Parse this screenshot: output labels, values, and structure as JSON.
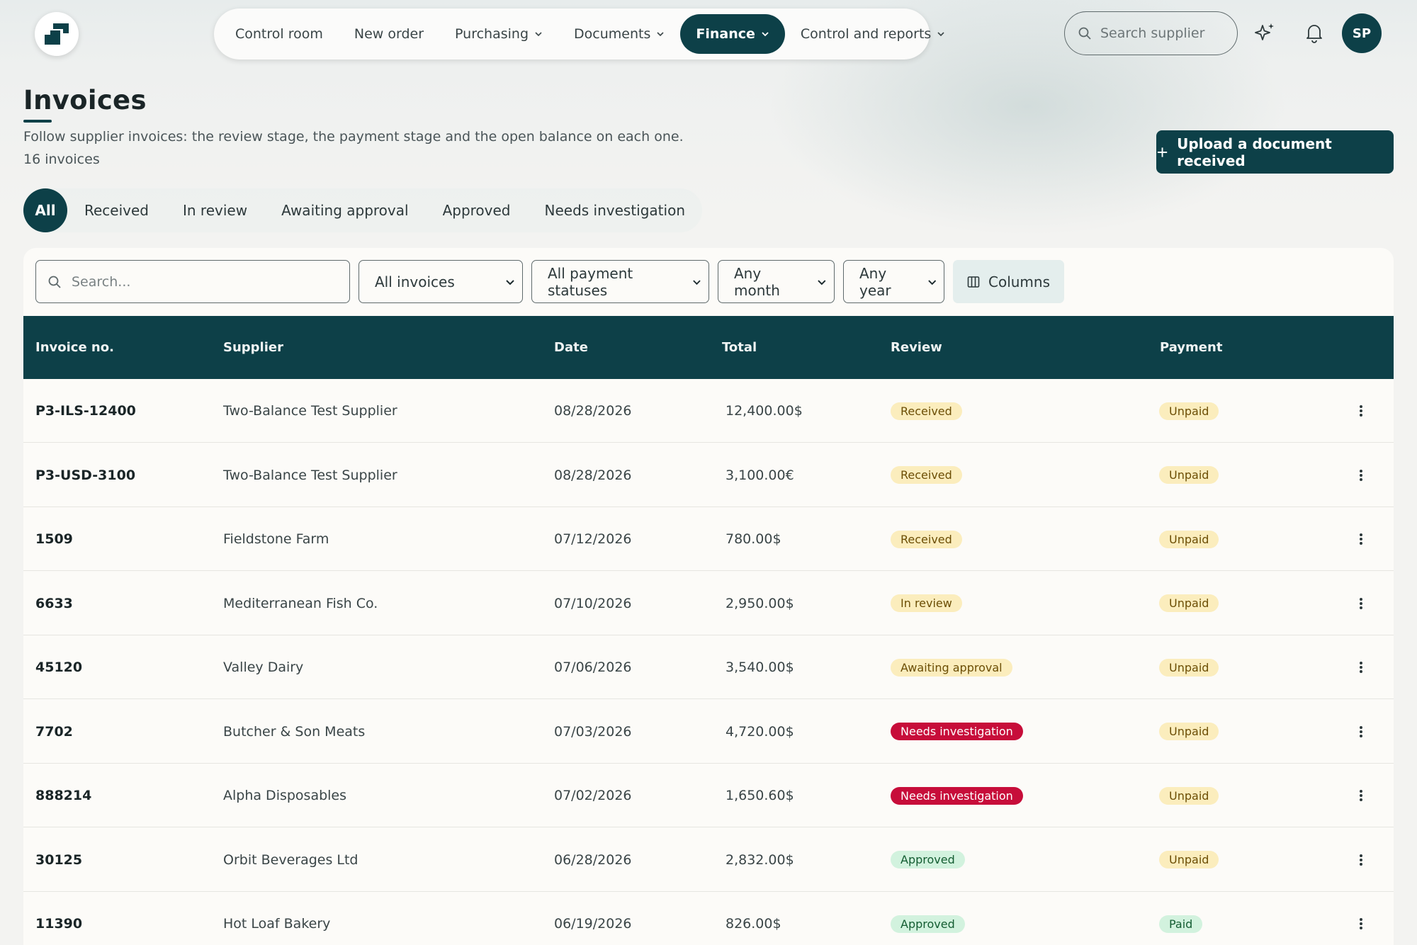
{
  "nav": {
    "items": [
      {
        "label": "Control room",
        "dropdown": false,
        "active": false
      },
      {
        "label": "New order",
        "dropdown": false,
        "active": false
      },
      {
        "label": "Purchasing",
        "dropdown": true,
        "active": false
      },
      {
        "label": "Documents",
        "dropdown": true,
        "active": false
      },
      {
        "label": "Finance",
        "dropdown": true,
        "active": true
      },
      {
        "label": "Control and reports",
        "dropdown": true,
        "active": false
      }
    ],
    "search_placeholder": "Search supplier",
    "avatar_initials": "SP"
  },
  "header": {
    "title": "Invoices",
    "subtitle": "Follow supplier invoices: the review stage, the payment stage and the open balance on each one.",
    "count": "16 invoices",
    "upload_button": "Upload a document received"
  },
  "tabs": [
    {
      "label": "All",
      "active": true
    },
    {
      "label": "Received",
      "active": false
    },
    {
      "label": "In review",
      "active": false
    },
    {
      "label": "Awaiting approval",
      "active": false
    },
    {
      "label": "Approved",
      "active": false
    },
    {
      "label": "Needs investigation",
      "active": false
    }
  ],
  "filters": {
    "search_placeholder": "Search...",
    "type": "All invoices",
    "payment_status": "All payment statuses",
    "month": "Any month",
    "year": "Any year",
    "columns_label": "Columns"
  },
  "table": {
    "columns": [
      "Invoice no.",
      "Supplier",
      "Date",
      "Total",
      "Review",
      "Payment"
    ],
    "rows": [
      {
        "invoice": "P3-ILS-12400",
        "supplier": "Two-Balance Test Supplier",
        "date": "08/28/2026",
        "total": "12,400.00$",
        "review": "Received",
        "review_tone": "yellow",
        "payment": "Unpaid",
        "payment_tone": "yellow"
      },
      {
        "invoice": "P3-USD-3100",
        "supplier": "Two-Balance Test Supplier",
        "date": "08/28/2026",
        "total": "3,100.00€",
        "review": "Received",
        "review_tone": "yellow",
        "payment": "Unpaid",
        "payment_tone": "yellow"
      },
      {
        "invoice": "1509",
        "supplier": "Fieldstone Farm",
        "date": "07/12/2026",
        "total": "780.00$",
        "review": "Received",
        "review_tone": "yellow",
        "payment": "Unpaid",
        "payment_tone": "yellow"
      },
      {
        "invoice": "6633",
        "supplier": "Mediterranean Fish Co.",
        "date": "07/10/2026",
        "total": "2,950.00$",
        "review": "In review",
        "review_tone": "yellow",
        "payment": "Unpaid",
        "payment_tone": "yellow"
      },
      {
        "invoice": "45120",
        "supplier": "Valley Dairy",
        "date": "07/06/2026",
        "total": "3,540.00$",
        "review": "Awaiting approval",
        "review_tone": "yellow",
        "payment": "Unpaid",
        "payment_tone": "yellow"
      },
      {
        "invoice": "7702",
        "supplier": "Butcher & Son Meats",
        "date": "07/03/2026",
        "total": "4,720.00$",
        "review": "Needs investigation",
        "review_tone": "red",
        "payment": "Unpaid",
        "payment_tone": "yellow"
      },
      {
        "invoice": "888214",
        "supplier": "Alpha Disposables",
        "date": "07/02/2026",
        "total": "1,650.60$",
        "review": "Needs investigation",
        "review_tone": "red",
        "payment": "Unpaid",
        "payment_tone": "yellow"
      },
      {
        "invoice": "30125",
        "supplier": "Orbit Beverages Ltd",
        "date": "06/28/2026",
        "total": "2,832.00$",
        "review": "Approved",
        "review_tone": "green",
        "payment": "Unpaid",
        "payment_tone": "yellow"
      },
      {
        "invoice": "11390",
        "supplier": "Hot Loaf Bakery",
        "date": "06/19/2026",
        "total": "826.00$",
        "review": "Approved",
        "review_tone": "green",
        "payment": "Paid",
        "payment_tone": "green"
      }
    ]
  },
  "colors": {
    "primary": "#0d4048",
    "badge_yellow_bg": "#fbedbd",
    "badge_red_bg": "#c70d3a",
    "badge_green_bg": "#d2f2de"
  }
}
